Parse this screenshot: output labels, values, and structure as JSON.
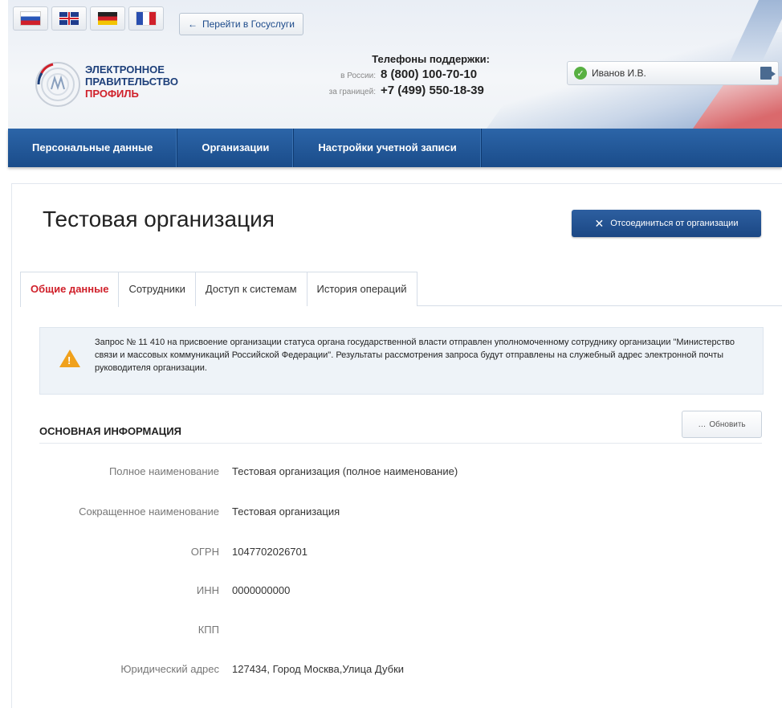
{
  "header": {
    "goto_label": "Перейти в Госуслуги",
    "logo": {
      "line1": "ЭЛЕКТРОННОЕ",
      "line2": "ПРАВИТЕЛЬСТВО",
      "line3": "ПРОФИЛЬ"
    },
    "support": {
      "title": "Телефоны поддержки:",
      "russia_label": "в России:",
      "russia_phone": "8 (800) 100-70-10",
      "abroad_label": "за границей:",
      "abroad_phone": "+7 (499) 550-18-39"
    },
    "user_name": "Иванов И.В.",
    "languages": [
      "ru",
      "en",
      "de",
      "fr"
    ]
  },
  "nav": [
    "Персональные данные",
    "Организации",
    "Настройки учетной записи"
  ],
  "page": {
    "title": "Тестовая организация",
    "disconnect_label": "Отсоединиться от организации",
    "tabs": [
      "Общие данные",
      "Сотрудники",
      "Доступ к системам",
      "История операций"
    ],
    "active_tab": 0
  },
  "alert": {
    "text": "Запрос № 11 410 на присвоение организации статуса органа государственной власти отправлен уполномоченному сотруднику организации \"Министерство связи и массовых коммуникаций Российской Федерации\". Результаты рассмотрения запроса будут отправлены на служебный адрес электронной почты руководителя организации."
  },
  "section": {
    "title": "ОСНОВНАЯ ИНФОРМАЦИЯ",
    "refresh_label": "Обновить"
  },
  "info": [
    {
      "label": "Полное наименование",
      "value": "Тестовая организация (полное наименование)"
    },
    {
      "label": "Сокращенное наименование",
      "value": "Тестовая организация"
    },
    {
      "label": "ОГРН",
      "value": "1047702026701"
    },
    {
      "label": "ИНН",
      "value": "0000000000"
    },
    {
      "label": "КПП",
      "value": ""
    },
    {
      "label": "Юридический адрес",
      "value": "127434, Город Москва,Улица Дубки"
    }
  ],
  "colors": {
    "brand_blue": "#1b4784",
    "accent_red": "#d0202a",
    "warning": "#f0a11c"
  }
}
